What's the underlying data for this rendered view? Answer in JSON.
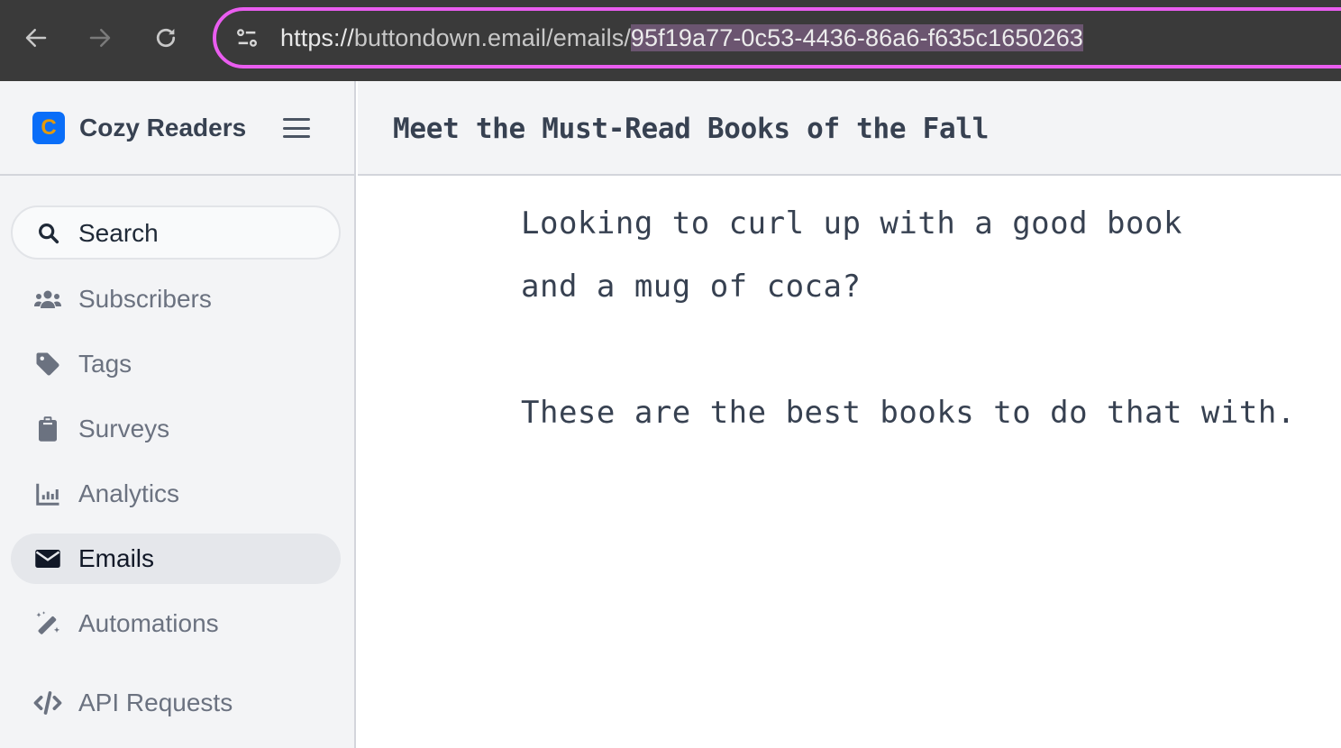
{
  "browser": {
    "url_scheme": "https://",
    "url_host": "buttondown.email",
    "url_path": "/emails/",
    "url_selected": "95f19a77-0c53-4436-86a6-f635c1650263",
    "accent_color": "#ea5df0"
  },
  "sidebar": {
    "logo_letter": "C",
    "brand_name": "Cozy Readers",
    "search_label": "Search",
    "items": [
      {
        "label": "Subscribers",
        "icon": "users-icon"
      },
      {
        "label": "Tags",
        "icon": "tag-icon"
      },
      {
        "label": "Surveys",
        "icon": "clipboard-icon"
      },
      {
        "label": "Analytics",
        "icon": "chart-icon"
      },
      {
        "label": "Emails",
        "icon": "envelope-icon",
        "active": true
      },
      {
        "label": "Automations",
        "icon": "magic-wand-icon"
      },
      {
        "label": "API Requests",
        "icon": "code-icon"
      }
    ]
  },
  "email": {
    "title": "Meet the Must-Read Books of the Fall",
    "body_lines": [
      "Looking to curl up with a good book",
      "and a mug of coca?",
      "",
      "These are the best books to do that with."
    ]
  }
}
